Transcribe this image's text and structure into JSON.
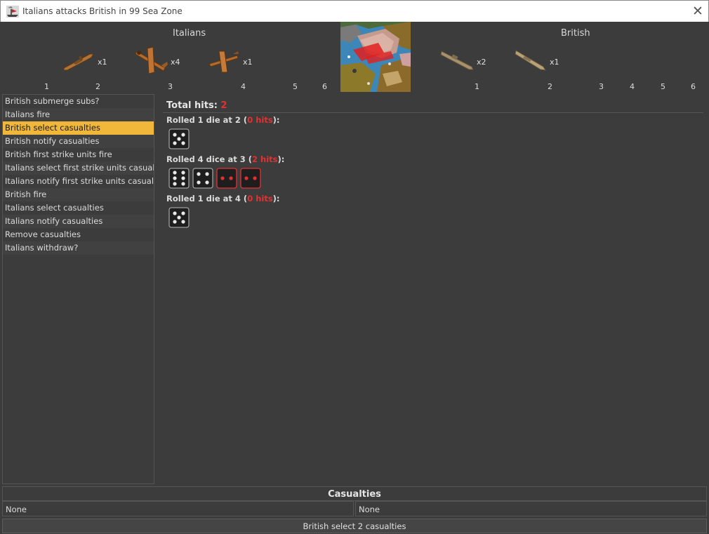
{
  "window": {
    "title": "Italians attacks British in 99 Sea Zone",
    "close_glyph": "✕"
  },
  "attacker": {
    "name": "Italians",
    "units": [
      {
        "icon": "cruiser-icon",
        "count": "x1"
      },
      {
        "icon": "fighter-plane-icon",
        "count": "x4"
      },
      {
        "icon": "tactical-bomber-icon",
        "count": "x1"
      }
    ],
    "dice_columns": [
      "1",
      "2",
      "3",
      "4",
      "5",
      "6"
    ]
  },
  "defender": {
    "name": "British",
    "units": [
      {
        "icon": "submarine-icon",
        "count": "x2"
      },
      {
        "icon": "destroyer-icon",
        "count": "x1"
      }
    ],
    "dice_columns": [
      "1",
      "2",
      "3",
      "4",
      "5",
      "6"
    ]
  },
  "steps": [
    "British submerge subs?",
    "Italians fire",
    "British select casualties",
    "British notify casualties",
    "British first strike units fire",
    "Italians select first strike units casualties",
    "Italians notify first strike units casualties",
    "British fire",
    "Italians select casualties",
    "Italians notify casualties",
    "Remove casualties",
    "Italians withdraw?"
  ],
  "selected_step": 2,
  "rolls": {
    "total_label": "Total hits: ",
    "total_value": "2",
    "groups": [
      {
        "prefix": "Rolled 1 die at 2 (",
        "hits": "0 hits",
        "suffix": "):",
        "dice": [
          {
            "value": 5,
            "hit": false
          }
        ]
      },
      {
        "prefix": "Rolled 4 dice at 3 (",
        "hits": "2 hits",
        "suffix": "):",
        "dice": [
          {
            "value": 6,
            "hit": false
          },
          {
            "value": 4,
            "hit": false
          },
          {
            "value": 2,
            "hit": true
          },
          {
            "value": 2,
            "hit": true
          }
        ]
      },
      {
        "prefix": "Rolled 1 die at 4 (",
        "hits": "0 hits",
        "suffix": "):",
        "dice": [
          {
            "value": 5,
            "hit": false
          }
        ]
      }
    ]
  },
  "casualties": {
    "title": "Casualties",
    "attacker": "None",
    "defender": "None"
  },
  "status_button": "British select 2 casualties",
  "colors": {
    "selected": "#f0b73a",
    "hit": "#e53030",
    "background": "#3c3c3c"
  }
}
